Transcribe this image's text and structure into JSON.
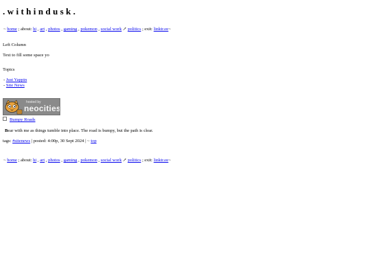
{
  "site": {
    "title": ".withindusk."
  },
  "nav": {
    "open": "~ ",
    "close": "~",
    "home": "home",
    "about_prefix": " ; about: ",
    "sep": " , ",
    "hi": "hi",
    "art": "art",
    "photos": "photos",
    "gaming": "gaming",
    "pokemon": "pokemon",
    "social_work": "social work",
    "politics_arrow": " ↗ ",
    "politics": "politics",
    "exit_prefix": " ; exit: ",
    "linktree": "linktr.ee"
  },
  "left_column": {
    "heading": "Left Column",
    "text": "Text to fill some space yo"
  },
  "topics": {
    "heading": "Topics",
    "items": [
      {
        "bullet": "- ",
        "label": "Just Yappin"
      },
      {
        "bullet": "- ",
        "label": "Site News"
      }
    ]
  },
  "badge": {
    "hosted_by": "hosted by",
    "brand": "neocities",
    "colors": {
      "bg": "#8a8a8a",
      "cat": "#e9a23b"
    }
  },
  "post": {
    "title": "Bumpy Roads",
    "body_initial": "B",
    "body_rest": "ear with me as things tumble into place. The road is bumpy, but the path is clear.",
    "tags_prefix": "tags: ",
    "tag": "#sitenews",
    "posted": " | posted: 4:00p, 30 Sept 2024 | ~ ",
    "top_link": "top"
  }
}
